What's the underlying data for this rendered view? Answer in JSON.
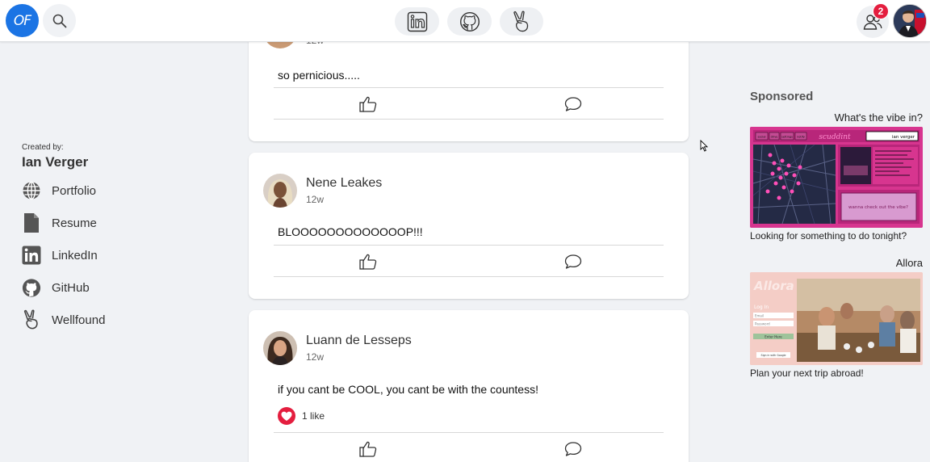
{
  "header": {
    "logo_text": "OF",
    "icons": [
      "search-icon",
      "linkedin-icon",
      "github-icon",
      "wellfound-icon",
      "friends-icon"
    ],
    "notification_count": "2"
  },
  "sidebar": {
    "created_by_label": "Created by:",
    "creator_name": "Ian Verger",
    "items": [
      {
        "label": "Portfolio",
        "icon": "globe-icon"
      },
      {
        "label": "Resume",
        "icon": "document-icon"
      },
      {
        "label": "LinkedIn",
        "icon": "linkedin-icon"
      },
      {
        "label": "GitHub",
        "icon": "github-icon"
      },
      {
        "label": "Wellfound",
        "icon": "wellfound-icon"
      }
    ]
  },
  "posts": [
    {
      "time": "12w",
      "text": "so pernicious....."
    },
    {
      "author": "Nene Leakes",
      "time": "12w",
      "text": "BLOOOOOOOOOOOOOP!!!"
    },
    {
      "author": "Luann de Lesseps",
      "time": "12w",
      "text": "if you cant be COOL, you cant be with the countess!",
      "likes": "1 like"
    }
  ],
  "right_sidebar": {
    "sponsored_label": "Sponsored",
    "ads": [
      {
        "title": "What's the vibe in?",
        "caption": "Looking for something to do tonight?",
        "image_text": {
          "brand": "scuddint",
          "user": "ian verger",
          "button": "wanna check out the vibe?",
          "tabs": [
            "social",
            "drive",
            "settings",
            "notify"
          ]
        }
      },
      {
        "title": "Allora",
        "caption": "Plan your next trip abroad!",
        "image_text": {
          "brand": "Allora",
          "login": "Log In",
          "email": "Email",
          "password": "Password",
          "button": "Enter Here",
          "google": "Sign in with Google"
        }
      }
    ]
  },
  "colors": {
    "brand_blue": "#1b74e4",
    "badge_red": "#e41e3f",
    "ad1_pink": "#d7358f",
    "ad2_pink": "#f4cdc6"
  }
}
